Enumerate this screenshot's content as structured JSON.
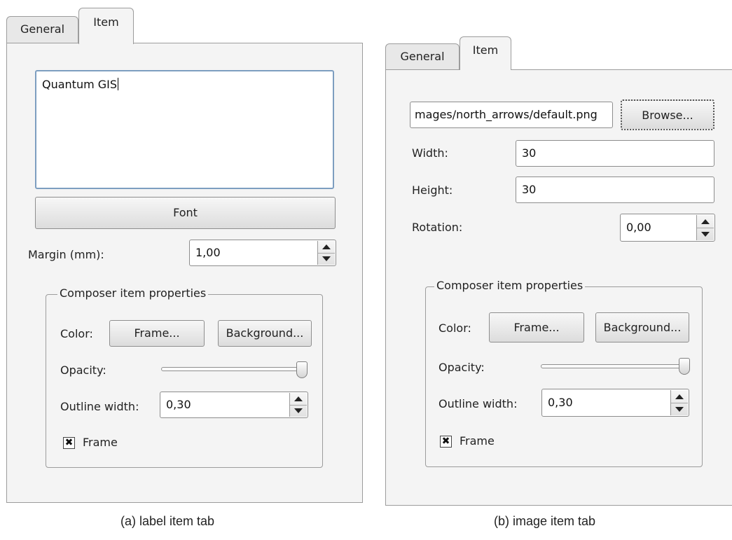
{
  "label_panel": {
    "tabs": [
      "General",
      "Item"
    ],
    "text_content": "Quantum GIS",
    "font_button": "Font",
    "margin_label": "Margin (mm):",
    "margin_value": "1,00",
    "group_title": "Composer item properties",
    "color_label": "Color:",
    "frame_button": "Frame...",
    "background_button": "Background...",
    "opacity_label": "Opacity:",
    "opacity_value": 1.0,
    "outline_label": "Outline width:",
    "outline_value": "0,30",
    "frame_checkbox_label": "Frame",
    "frame_checked": true
  },
  "image_panel": {
    "tabs": [
      "General",
      "Item"
    ],
    "path_value": "mages/north_arrows/default.png",
    "browse_button": "Browse...",
    "width_label": "Width:",
    "width_value": "30",
    "height_label": "Height:",
    "height_value": "30",
    "rotation_label": "Rotation:",
    "rotation_value": "0,00",
    "group_title": "Composer item properties",
    "color_label": "Color:",
    "frame_button": "Frame...",
    "background_button": "Background...",
    "opacity_label": "Opacity:",
    "opacity_value": 1.0,
    "outline_label": "Outline width:",
    "outline_value": "0,30",
    "frame_checkbox_label": "Frame",
    "frame_checked": true
  },
  "captions": {
    "left": "(a)  label item tab",
    "right": "(b)  image item tab"
  },
  "icons": {
    "spin_up": "arrow-up-icon",
    "spin_down": "arrow-down-icon",
    "check": "check-x-icon"
  }
}
